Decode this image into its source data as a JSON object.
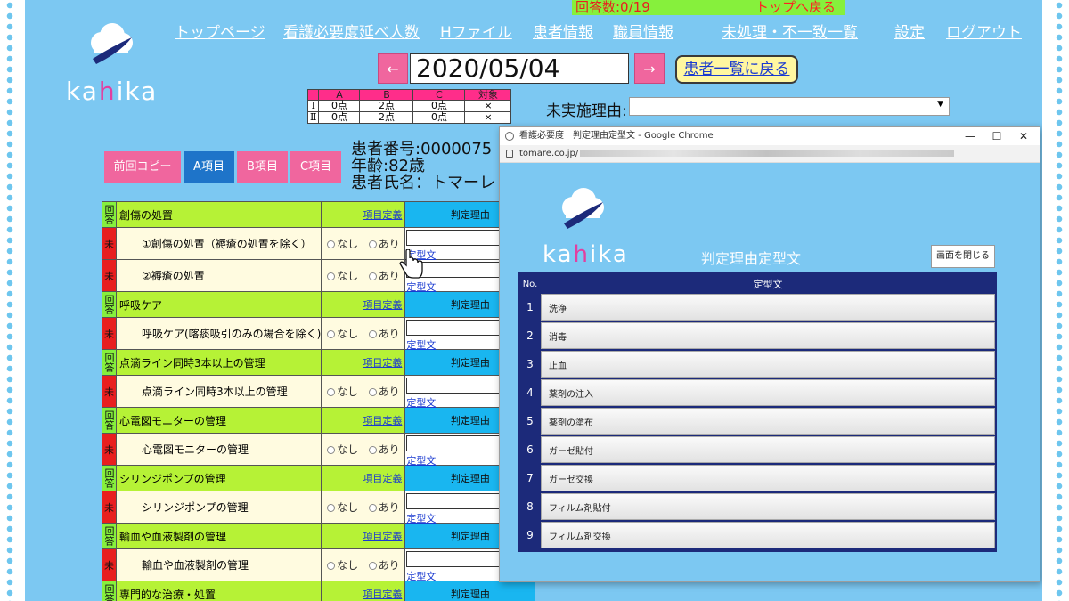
{
  "status": {
    "answer_count": "回答数:0/19",
    "top_link": "トップへ戻る"
  },
  "nav": [
    {
      "label": "トップページ"
    },
    {
      "label": "看護必要度延べ人数"
    },
    {
      "label": "Hファイル"
    },
    {
      "label": "患者情報"
    },
    {
      "label": "職員情報"
    },
    {
      "label": "未処理・不一致一覧"
    },
    {
      "label": "設定"
    },
    {
      "label": "ログアウト"
    }
  ],
  "logo": {
    "text_pre": "ka",
    "text_i": "h",
    "text_post": "ika"
  },
  "date": {
    "prev": "←",
    "value": "2020/05/04",
    "next": "→",
    "back_to_list": "患者一覧に戻る"
  },
  "score_table": {
    "headers": [
      "",
      "A",
      "B",
      "C",
      "対象"
    ],
    "rows": [
      [
        "Ⅰ",
        "0点",
        "2点",
        "0点",
        "×"
      ],
      [
        "Ⅱ",
        "0点",
        "2点",
        "0点",
        "×"
      ]
    ]
  },
  "unimplemented": {
    "label": "未実施理由:",
    "value": ""
  },
  "tabs": {
    "prev_copy": "前回コピー",
    "a_item": "A項目",
    "b_item": "B項目",
    "c_item": "C項目"
  },
  "patient": {
    "id_line": "患者番号:0000075",
    "age_line": "年齢:82歳",
    "name_line": "患者氏名：トマーレ 太"
  },
  "grid": {
    "cat_badge": "回答",
    "item_badge": "未",
    "def_link": "項目定義",
    "reason_header": "判定理由",
    "no_label": "なし",
    "yes_label": "あり",
    "reason_link": "定型文",
    "sections": [
      {
        "title": "創傷の処置",
        "items": [
          "①創傷の処置（褥瘡の処置を除く）",
          "②褥瘡の処置"
        ]
      },
      {
        "title": "呼吸ケア",
        "items": [
          "呼吸ケア(喀痰吸引のみの場合を除く)"
        ]
      },
      {
        "title": "点滴ライン同時3本以上の管理",
        "items": [
          "点滴ライン同時3本以上の管理"
        ]
      },
      {
        "title": "心電図モニターの管理",
        "items": [
          "心電図モニターの管理"
        ]
      },
      {
        "title": "シリンジポンプの管理",
        "items": [
          "シリンジポンプの管理"
        ]
      },
      {
        "title": "輸血や血液製剤の管理",
        "items": [
          "輸血や血液製剤の管理"
        ]
      },
      {
        "title": "専門的な治療・処置",
        "items": []
      }
    ]
  },
  "popup": {
    "window_title": "看護必要度　判定理由定型文 - Google Chrome",
    "url": "tomare.co.jp/",
    "title": "判定理由定型文",
    "close_button": "画面を閉じる",
    "col_no": "No.",
    "col_text": "定型文",
    "rows": [
      {
        "no": "1",
        "text": "洗浄"
      },
      {
        "no": "2",
        "text": "消毒"
      },
      {
        "no": "3",
        "text": "止血"
      },
      {
        "no": "4",
        "text": "薬剤の注入"
      },
      {
        "no": "5",
        "text": "薬剤の塗布"
      },
      {
        "no": "6",
        "text": "ガーゼ貼付"
      },
      {
        "no": "7",
        "text": "ガーゼ交換"
      },
      {
        "no": "8",
        "text": "フィルム剤貼付"
      },
      {
        "no": "9",
        "text": "フィルム剤交換"
      }
    ]
  },
  "colors": {
    "background": "#7cc8f2",
    "pink_button": "#f0669e",
    "blue_tab": "#1e74c9",
    "green_header": "#b6f236",
    "red_badge": "#e81f1f",
    "popup_navy": "#1c2a7a"
  }
}
